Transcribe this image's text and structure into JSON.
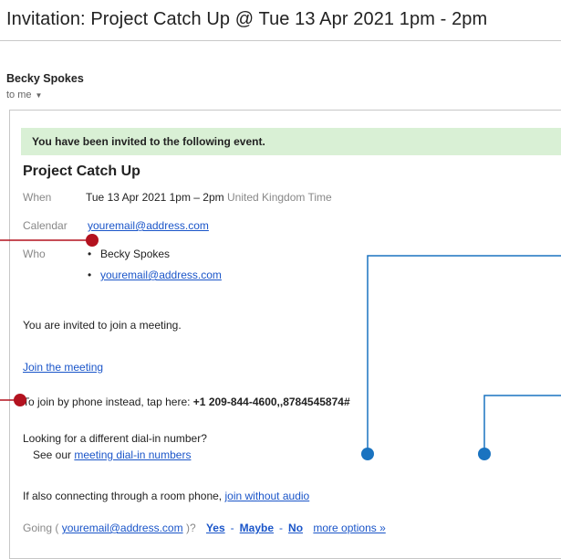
{
  "header": {
    "subject": "Invitation: Project Catch Up @ Tue 13 Apr 2021 1pm - 2pm"
  },
  "sender": {
    "name": "Becky Spokes",
    "to": "to me"
  },
  "banner": {
    "text": "You have been invited to the following event."
  },
  "event": {
    "title": "Project Catch Up",
    "when_label": "When",
    "when_value": "Tue 13 Apr 2021 1pm – 2pm",
    "timezone": "United Kingdom Time",
    "calendar_label": "Calendar",
    "calendar_value": "youremail@address.com",
    "who_label": "Who",
    "guests": [
      "Becky Spokes",
      "youremail@address.com"
    ]
  },
  "body": {
    "invite_line": "You are invited to join a meeting.",
    "join_link": "Join the meeting",
    "phone_prefix": "To join by phone instead, tap here: ",
    "phone_number": "+1 209-844-4600,,8784545874#",
    "dialin_question": "Looking for a different dial-in number?",
    "dialin_prefix": "See our ",
    "dialin_link": "meeting dial-in numbers",
    "room_prefix": "If also connecting through a room phone, ",
    "room_link": "join without audio"
  },
  "rsvp": {
    "prefix": "Going (",
    "email": "youremail@address.com",
    "suffix": ")?",
    "yes": "Yes",
    "maybe": "Maybe",
    "no": "No",
    "more": "more options »",
    "sep": "-"
  },
  "colors": {
    "annotation_red": "#b3121f",
    "annotation_blue": "#1a73c0",
    "banner_green": "#d9f0d5",
    "link_blue": "#1a55c9"
  }
}
